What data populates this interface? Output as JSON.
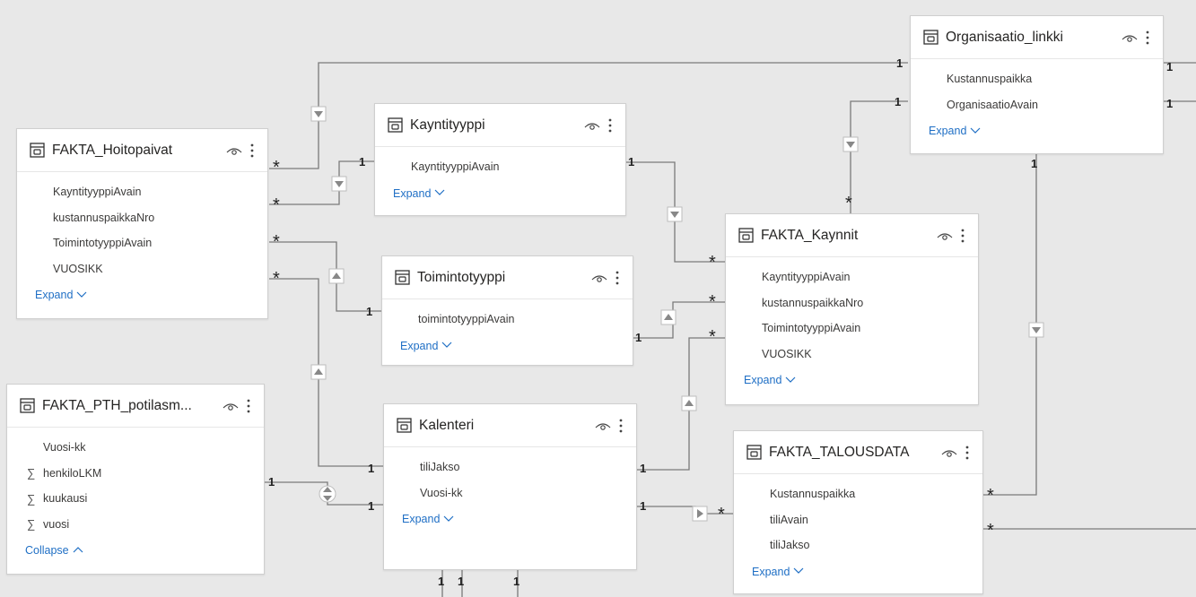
{
  "tables": [
    {
      "id": "fakta_hoitopaivat",
      "title": "FAKTA_Hoitopaivat",
      "fields": [
        {
          "name": "KayntityyppiAvain"
        },
        {
          "name": "kustannuspaikkaNro"
        },
        {
          "name": "ToimintotyyppiAvain"
        },
        {
          "name": "VUOSIKK"
        }
      ],
      "toggle": "Expand"
    },
    {
      "id": "kayntityyppi",
      "title": "Kayntityyppi",
      "fields": [
        {
          "name": "KayntityyppiAvain"
        }
      ],
      "toggle": "Expand"
    },
    {
      "id": "toimintotyyppi",
      "title": "Toimintotyyppi",
      "fields": [
        {
          "name": "toimintotyyppiAvain"
        }
      ],
      "toggle": "Expand"
    },
    {
      "id": "organisaatio_linkki",
      "title": "Organisaatio_linkki",
      "fields": [
        {
          "name": "Kustannuspaikka"
        },
        {
          "name": "OrganisaatioAvain"
        }
      ],
      "toggle": "Expand"
    },
    {
      "id": "fakta_kaynnit",
      "title": "FAKTA_Kaynnit",
      "fields": [
        {
          "name": "KayntityyppiAvain"
        },
        {
          "name": "kustannuspaikkaNro"
        },
        {
          "name": "ToimintotyyppiAvain"
        },
        {
          "name": "VUOSIKK"
        }
      ],
      "toggle": "Expand"
    },
    {
      "id": "fakta_pth",
      "title": "FAKTA_PTH_potilasm...",
      "fields": [
        {
          "name": "Vuosi-kk"
        },
        {
          "name": "henkiloLKM",
          "sigma": "∑"
        },
        {
          "name": "kuukausi",
          "sigma": "∑"
        },
        {
          "name": "vuosi",
          "sigma": "∑"
        }
      ],
      "toggle": "Collapse"
    },
    {
      "id": "kalenteri",
      "title": "Kalenteri",
      "fields": [
        {
          "name": "tiliJakso"
        },
        {
          "name": "Vuosi-kk"
        }
      ],
      "toggle": "Expand"
    },
    {
      "id": "fakta_talousdata",
      "title": "FAKTA_TALOUSDATA",
      "fields": [
        {
          "name": "Kustannuspaikka"
        },
        {
          "name": "tiliAvain"
        },
        {
          "name": "tiliJakso"
        }
      ],
      "toggle": "Expand"
    }
  ],
  "cardinality": {
    "one": "1",
    "many": "*"
  },
  "icons": {
    "table": "table-icon",
    "visibility": "eye-icon",
    "more": "more-options-icon",
    "chevron_down": "chevron-down-icon",
    "chevron_up": "chevron-up-icon"
  },
  "colors": {
    "canvas": "#e8e8e8",
    "card": "#ffffff",
    "link": "#1f6fc5",
    "line": "#7a7a7a"
  }
}
